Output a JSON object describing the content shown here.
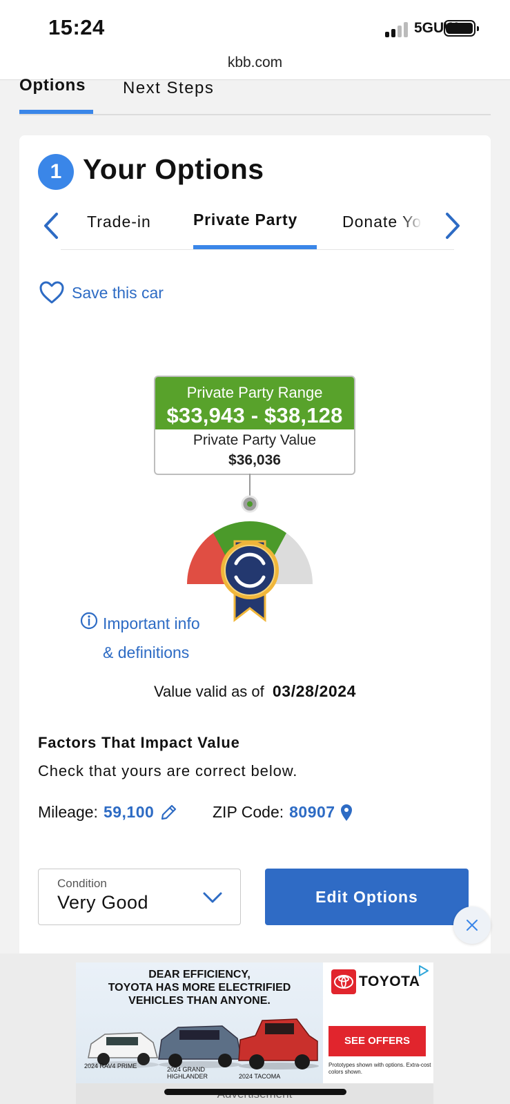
{
  "status_bar": {
    "time": "15:24",
    "network": "5GUW"
  },
  "browser": {
    "url": "kbb.com"
  },
  "top_tabs": [
    {
      "label": "Options",
      "active": true
    },
    {
      "label": "Next Steps",
      "active": false
    }
  ],
  "card": {
    "step_number": "1",
    "title": "Your Options",
    "value_tabs": [
      {
        "label": "Trade-in",
        "active": false
      },
      {
        "label": "Private Party",
        "active": true
      },
      {
        "label": "Donate Yo",
        "active": false
      }
    ],
    "save_car_label": "Save this car",
    "range_label": "Private Party Range",
    "range_value": "$33,943 - $38,128",
    "value_label": "Private Party Value",
    "value": "$36,036",
    "info_line1": "Important info",
    "info_line2": "& definitions",
    "valid_label": "Value valid as of",
    "valid_date": "03/28/2024",
    "factors_title": "Factors That Impact Value",
    "factors_subtitle": "Check that yours are correct below.",
    "mileage_label": "Mileage:",
    "mileage_value": "59,100",
    "zip_label": "ZIP Code:",
    "zip_value": "80907",
    "condition_label": "Condition",
    "condition_value": "Very Good",
    "edit_button": "Edit Options"
  },
  "colors": {
    "accent": "#3a86e8",
    "link": "#2d6bc4",
    "range_green": "#58a22b",
    "button_blue": "#2f6bc5",
    "gauge_red": "#e04e43"
  },
  "ad": {
    "headline": [
      "DEAR EFFICIENCY,",
      "TOYOTA HAS MORE ELECTRIFIED",
      "VEHICLES THAN ANYONE."
    ],
    "brand": "TOYOTA",
    "cta": "SEE OFFERS",
    "captions": [
      "2024 RAV4 PRIME",
      "2024 GRAND",
      "HIGHLANDER",
      "2024 TACOMA"
    ],
    "disclaimer": "Prototypes shown with options. Extra-cost colors shown.",
    "footer": "Advertisement"
  }
}
